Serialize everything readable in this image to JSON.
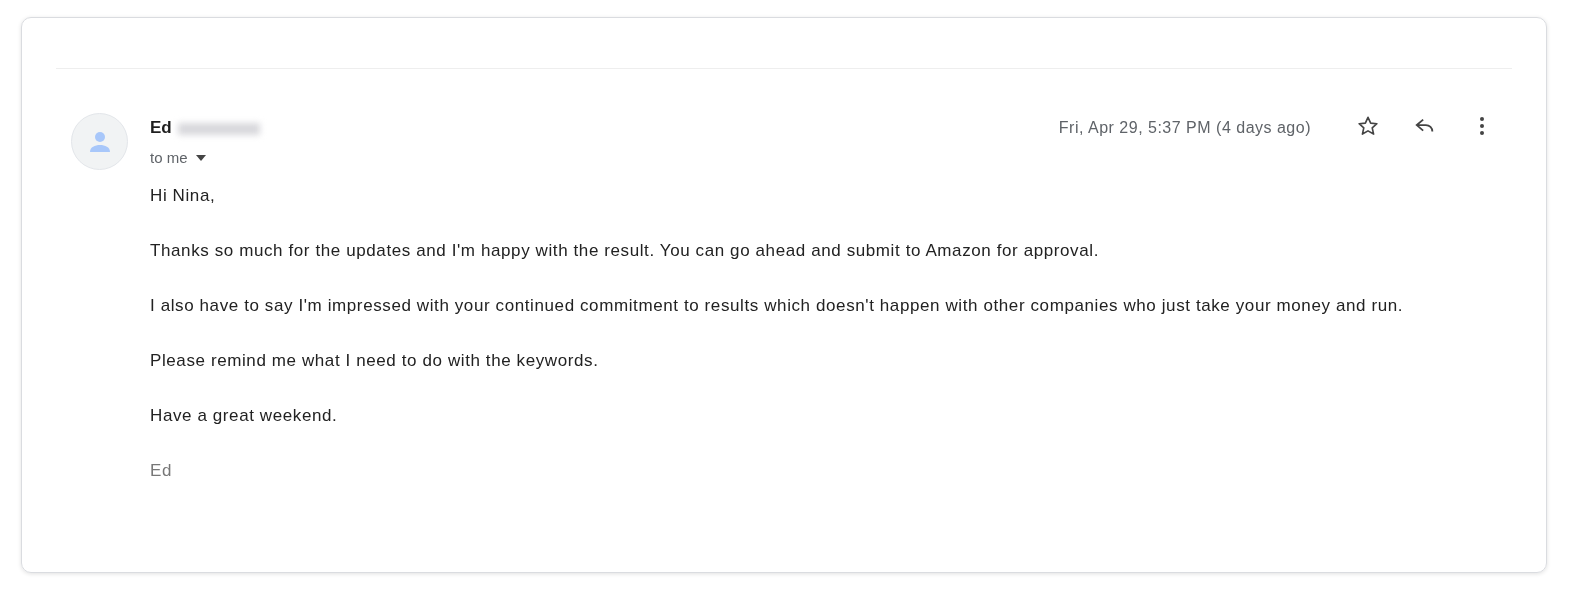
{
  "message": {
    "sender": "Ed",
    "recipient": "to me",
    "date": "Fri, Apr 29, 5:37 PM (4 days ago)",
    "starred": false,
    "body": [
      "Hi Nina,",
      "Thanks so much for the updates and I'm happy with the result. You can go ahead and submit to Amazon for approval.",
      "I also have to say I'm impressed with your continued commitment to results which doesn't happen with other companies who just take your money and run.",
      "Please remind me what I need to do with the keywords.",
      "Have a great weekend."
    ],
    "signature": "Ed"
  }
}
